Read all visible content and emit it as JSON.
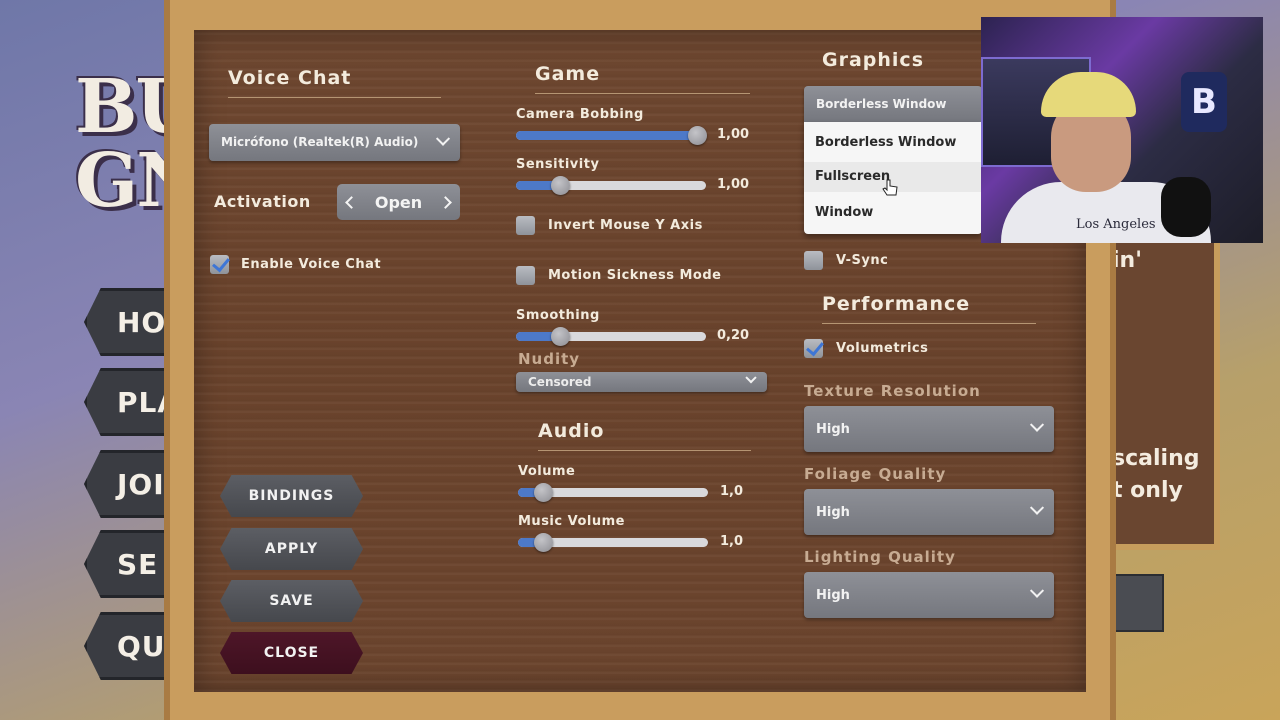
{
  "background": {
    "title_line1": "BU",
    "title_line2": "GN",
    "menu": [
      "HOS",
      "PLAY",
      "JOI",
      "SE",
      "QU"
    ],
    "right_fragments": [
      "in'",
      "scaling",
      "t only"
    ]
  },
  "voice_chat": {
    "title": "Voice Chat",
    "device": "Micrófono (Realtek(R) Audio)",
    "activation_label": "Activation",
    "activation_value": "Open",
    "enable_label": "Enable Voice Chat",
    "enable_checked": true
  },
  "buttons": {
    "bindings": "BINDINGS",
    "apply": "APPLY",
    "save": "SAVE",
    "close": "CLOSE"
  },
  "game": {
    "title": "Game",
    "camera_bobbing": {
      "label": "Camera Bobbing",
      "value": "1,00",
      "fraction": 1.0
    },
    "sensitivity": {
      "label": "Sensitivity",
      "value": "1,00",
      "fraction": 0.23
    },
    "invert_mouse": {
      "label": "Invert Mouse Y Axis",
      "checked": false
    },
    "motion_sickness": {
      "label": "Motion Sickness Mode",
      "checked": false
    },
    "smoothing": {
      "label": "Smoothing",
      "value": "0,20",
      "fraction": 0.23
    },
    "nudity_label": "Nudity",
    "nudity_value": "Censored"
  },
  "audio": {
    "title": "Audio",
    "volume": {
      "label": "Volume",
      "value": "1,0",
      "fraction": 0.13
    },
    "music_volume": {
      "label": "Music Volume",
      "value": "1,0",
      "fraction": 0.13
    }
  },
  "graphics": {
    "title": "Graphics",
    "window_mode_selected": "Borderless Window",
    "window_mode_options": [
      "Borderless Window",
      "Fullscreen",
      "Window"
    ],
    "vsync_label": "V-Sync",
    "vsync_checked": false
  },
  "performance": {
    "title": "Performance",
    "volumetrics_label": "Volumetrics",
    "volumetrics_checked": true,
    "texture_label": "Texture Resolution",
    "texture_value": "High",
    "foliage_label": "Foliage Quality",
    "foliage_value": "High",
    "lighting_label": "Lighting Quality",
    "lighting_value": "High"
  },
  "webcam": {
    "logo_letter": "B",
    "shirt_text": "Los Angeles"
  },
  "colors": {
    "wood": "#6b442d",
    "frame": "#c99d5e",
    "slider_fill": "#4d79c8",
    "close_button": "#4a1425"
  }
}
